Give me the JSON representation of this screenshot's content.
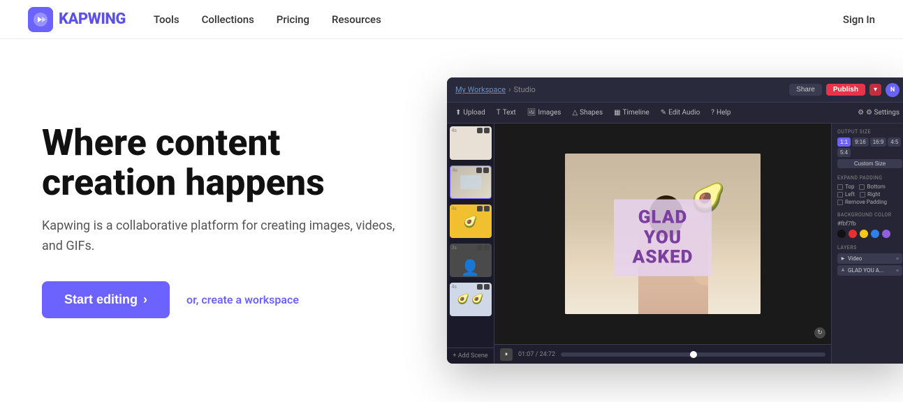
{
  "navbar": {
    "logo_text": "KAPWING",
    "links": [
      {
        "label": "Tools",
        "id": "tools"
      },
      {
        "label": "Collections",
        "id": "collections"
      },
      {
        "label": "Pricing",
        "id": "pricing"
      },
      {
        "label": "Resources",
        "id": "resources"
      }
    ],
    "signin_label": "Sign In"
  },
  "hero": {
    "title": "Where content creation happens",
    "subtitle": "Kapwing is a collaborative platform for creating images, videos, and GIFs.",
    "cta_label": "Start editing",
    "cta_arrow": "›",
    "workspace_label": "or, create a workspace"
  },
  "studio": {
    "breadcrumb_workspace": "My Workspace",
    "breadcrumb_separator": "›",
    "breadcrumb_page": "Studio",
    "share_label": "Share",
    "publish_label": "Publish",
    "avatar_label": "N",
    "settings_label": "⚙ Settings",
    "toolbar_items": [
      {
        "icon": "⬆",
        "label": "Upload"
      },
      {
        "icon": "T",
        "label": "Text"
      },
      {
        "icon": "🖼",
        "label": "Images"
      },
      {
        "icon": "△",
        "label": "Shapes"
      },
      {
        "icon": "▦",
        "label": "Timeline"
      },
      {
        "icon": "✎",
        "label": "Edit Audio"
      },
      {
        "icon": "?",
        "label": "Help"
      }
    ],
    "canvas_text": "GLAD YOU ASKED",
    "timeline_time": "01:07 / 24:72",
    "add_scene_label": "+ Add Scene",
    "panel": {
      "output_size_label": "OUTPUT SIZE",
      "sizes": [
        "1:1",
        "9:16",
        "16:9",
        "4:5",
        "5:4"
      ],
      "active_size": "1:1",
      "custom_size_label": "Custom Size",
      "expand_padding_label": "EXPAND PADDING",
      "padding_options": [
        "Top",
        "Bottom",
        "Left",
        "Right",
        "Remove Padding"
      ],
      "bg_color_label": "BACKGROUND COLOR",
      "bg_color_value": "#fbf7fb",
      "layers_label": "LAYERS",
      "layers": [
        {
          "icon": "▶",
          "label": "Video"
        },
        {
          "icon": "A",
          "label": "GLAD YOU A..."
        }
      ]
    }
  },
  "colors": {
    "accent": "#6c63ff",
    "publish": "#e8344a"
  }
}
